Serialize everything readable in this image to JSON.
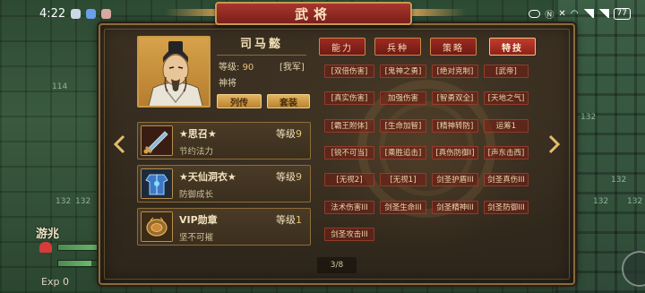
{
  "status_bar": {
    "time": "4:22",
    "battery": "77"
  },
  "map": {
    "numbers": [
      "114",
      "132",
      "132",
      "132",
      "132",
      "132",
      "132"
    ]
  },
  "hud": {
    "name": "游兆",
    "hp": "51",
    "mp": "31",
    "exp_label": "Exp",
    "exp_value": "0"
  },
  "panel": {
    "title": "武将",
    "hero": {
      "name": "司马懿",
      "level_label": "等级:",
      "level_value": "90",
      "faction": "[我军]",
      "rank": "神将",
      "btn_biography": "列传",
      "btn_outfit": "套装"
    },
    "tabs": [
      {
        "label": "能力",
        "active": false
      },
      {
        "label": "兵种",
        "active": false
      },
      {
        "label": "策略",
        "active": false
      },
      {
        "label": "特技",
        "active": true
      }
    ],
    "skills": [
      [
        "[双倍伤害]",
        "[鬼神之勇]",
        "[绝对克制]",
        "[武帝]"
      ],
      [
        "[真实伤害]",
        "加强伤害",
        "[智勇双全]",
        "[天地之气]"
      ],
      [
        "[霸王附体]",
        "[生命加智]",
        "[精神转防]",
        "运筹1"
      ],
      [
        "[锐不可当]",
        "[乘胜追击]",
        "[真伤防御Ⅰ]",
        "[声东击西]"
      ],
      [
        "[无视2]",
        "[无视1]",
        "剑圣护盾III",
        "剑圣真伤III"
      ],
      [
        "法术伤害III",
        "剑圣生命III",
        "剑圣精神III",
        "剑圣防御III"
      ],
      [
        "剑圣攻击III"
      ]
    ],
    "equipment": [
      {
        "name": "★思召★",
        "level_label": "等级",
        "level": "9",
        "desc": "节约法力"
      },
      {
        "name": "★天仙洞衣★",
        "level_label": "等级",
        "level": "9",
        "desc": "防御成长"
      },
      {
        "name": "VIP勋章",
        "level_label": "等级",
        "level": "1",
        "desc": "坚不可摧"
      }
    ],
    "pager": "3/8"
  },
  "colors": {
    "tab_red": "#9c2a22",
    "gold_border": "#c99a4a",
    "skill_bg": "#781e14"
  }
}
